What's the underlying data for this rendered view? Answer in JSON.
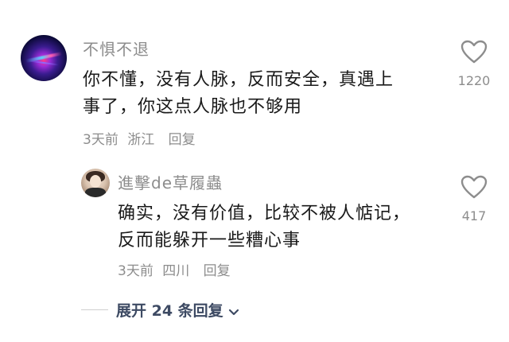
{
  "comment": {
    "username": "不惧不退",
    "text_line1": "你不懂，没有人脉，反而安全，真遇上",
    "text_line2": "事了，你这点人脉也不够用",
    "time": "3天前",
    "location": "浙江",
    "reply_label": "回复",
    "like_count": "1220"
  },
  "reply": {
    "username": "進擊de草履蟲",
    "text_line1": "确实，没有价值，比较不被人惦记，",
    "text_line2": "反而能躲开一些糟心事",
    "time": "3天前",
    "location": "四川",
    "reply_label": "回复",
    "like_count": "417"
  },
  "expand_label": "展开 24 条回复",
  "colors": {
    "text_primary": "#1a1a1a",
    "text_secondary": "#8d8d8d",
    "expand_text": "#3d4a63"
  },
  "icons": {
    "like": "heart-outline-icon",
    "expand": "chevron-down-icon"
  }
}
